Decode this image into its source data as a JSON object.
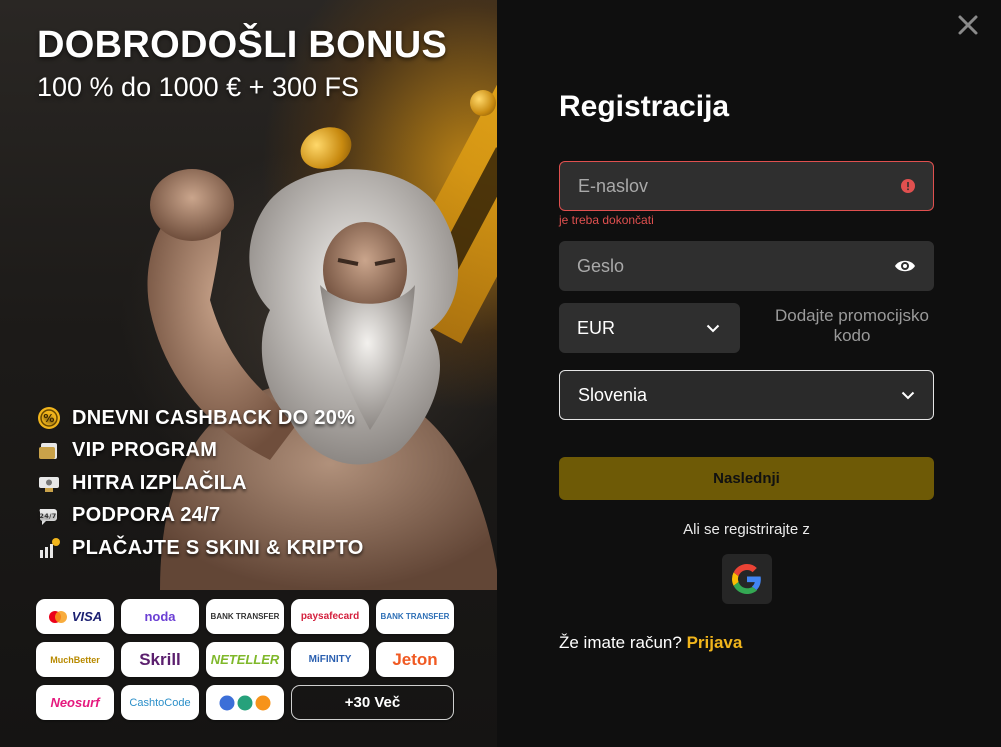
{
  "promo": {
    "headline": "DOBRODOŠLI BONUS",
    "subline": "100 % do 1000 € + 300 FS",
    "perks": [
      {
        "label": "DNEVNI CASHBACK DO 20%",
        "icon": "percent-coin-icon"
      },
      {
        "label": "VIP PROGRAM",
        "icon": "vip-card-icon"
      },
      {
        "label": "HITRA IZPLAČILA",
        "icon": "cash-icon"
      },
      {
        "label": "PODPORA 24/7",
        "icon": "support-chat-icon"
      },
      {
        "label": "PLAČAJTE S SKINI & KRIPTO",
        "icon": "crypto-chart-icon"
      }
    ],
    "payments": [
      "VISA",
      "noda",
      "BANK TRANSFER",
      "paysafecard",
      "BANK TRANSFER",
      "MuchBetter",
      "Skrill",
      "NETELLER",
      "MiFINITY",
      "Jeton",
      "Neosurf",
      "CashtoCode",
      "₮ ₿"
    ],
    "more_label": "+30 Več"
  },
  "form": {
    "title": "Registracija",
    "email_placeholder": "E-naslov",
    "email_error": "je treba dokončati",
    "password_placeholder": "Geslo",
    "currency": "EUR",
    "promo_code_link": "Dodajte promocijsko kodo",
    "country": "Slovenia",
    "next_label": "Naslednji",
    "social_label": "Ali se registrirajte z",
    "login_prompt": "Že imate račun?",
    "login_link": "Prijava"
  },
  "colors": {
    "accent": "#f1b51c",
    "error": "#e0504f",
    "button_disabled": "#6e5a06"
  }
}
